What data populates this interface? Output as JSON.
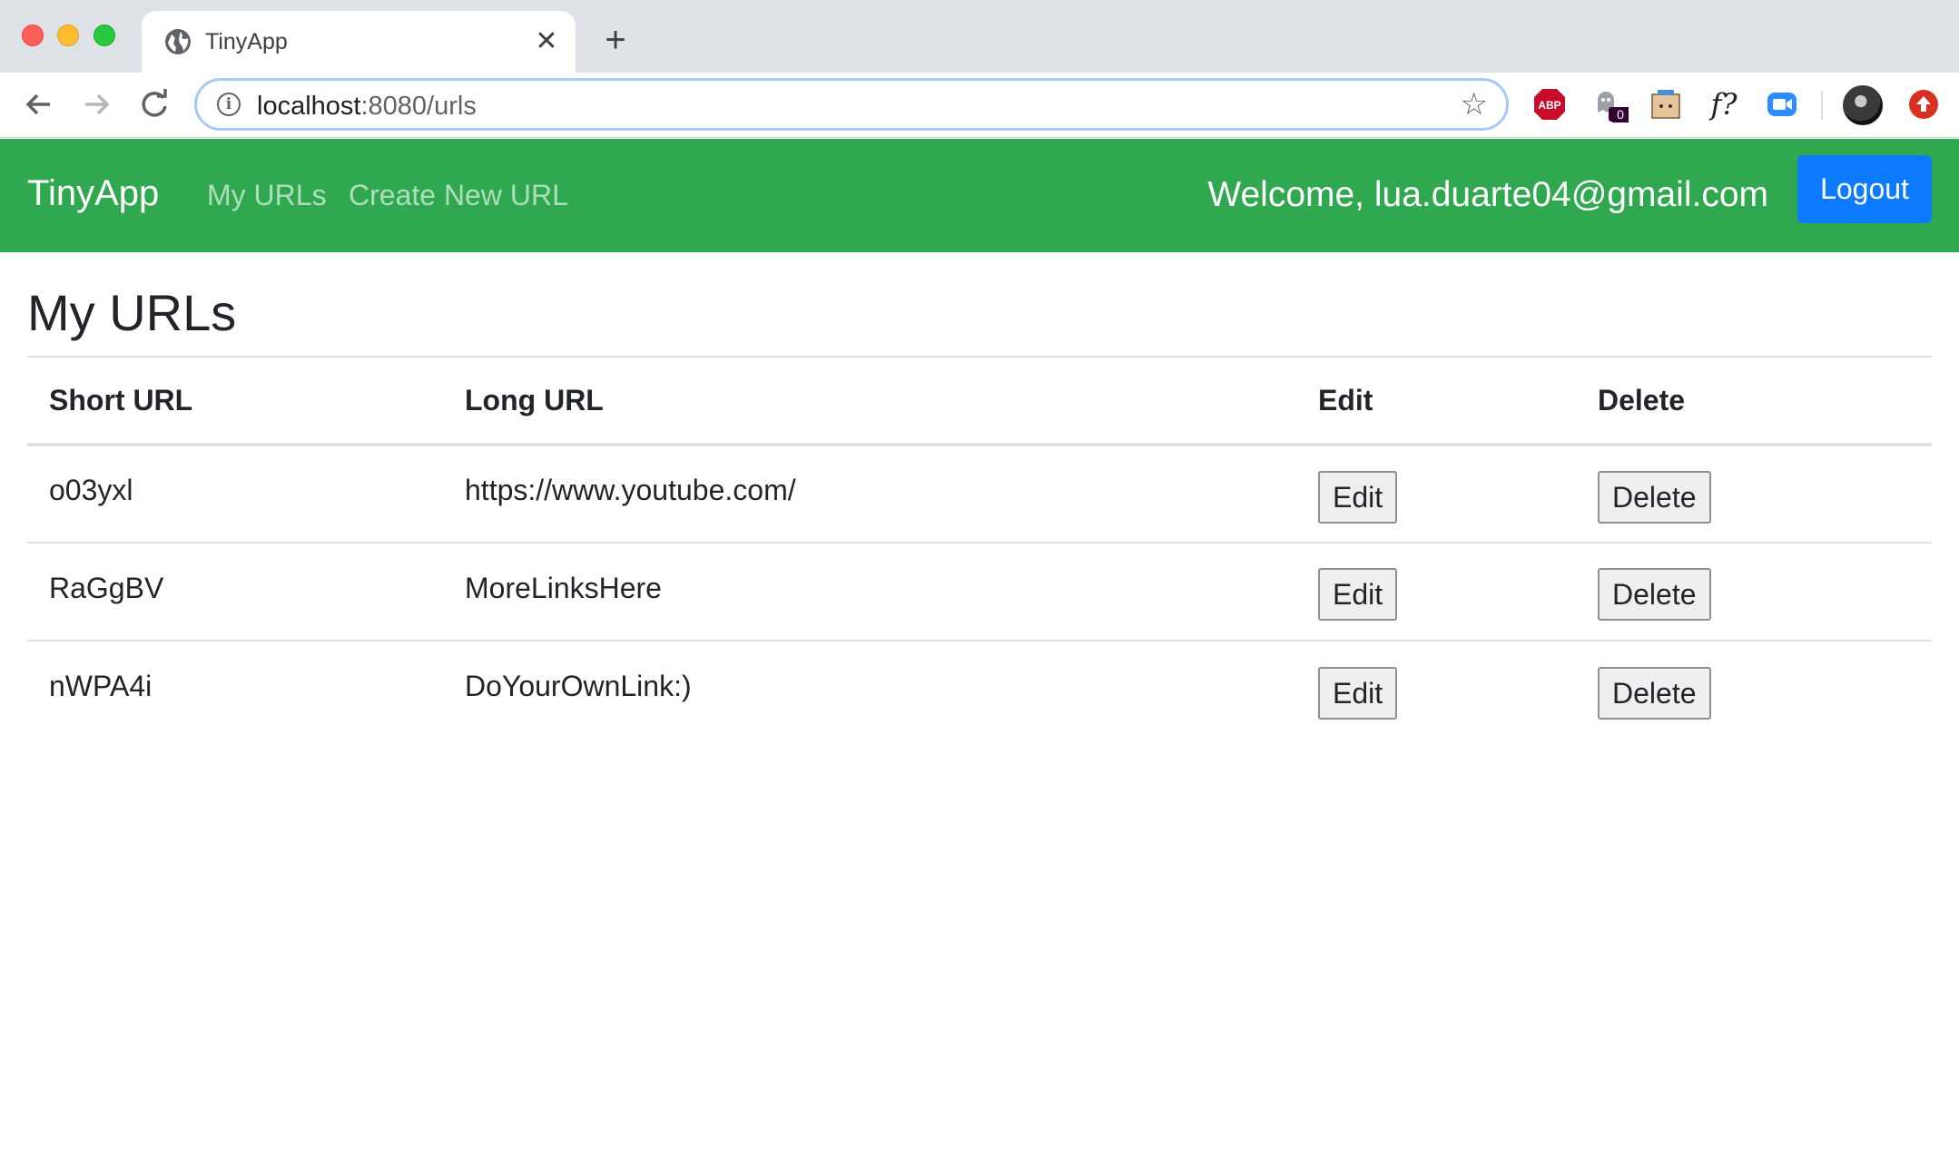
{
  "browser": {
    "tab_title": "TinyApp",
    "tab_close": "✕",
    "new_tab": "+",
    "url_host": "localhost",
    "url_rest": ":8080/urls",
    "ghost_badge": "0",
    "ext_font_label": "f?"
  },
  "navbar": {
    "brand": "TinyApp",
    "links": [
      "My URLs",
      "Create New URL"
    ],
    "welcome": "Welcome, lua.duarte04@gmail.com",
    "logout_label": "Logout",
    "bg_color": "#2fa84f",
    "button_color": "#0d7bff"
  },
  "main": {
    "title": "My URLs",
    "table": {
      "headers": [
        "Short URL",
        "Long URL",
        "Edit",
        "Delete"
      ],
      "rows": [
        {
          "short": "o03yxl",
          "long": "https://www.youtube.com/",
          "edit": "Edit",
          "delete": "Delete"
        },
        {
          "short": "RaGgBV",
          "long": "MoreLinksHere",
          "edit": "Edit",
          "delete": "Delete"
        },
        {
          "short": "nWPA4i",
          "long": "DoYourOwnLink:)",
          "edit": "Edit",
          "delete": "Delete"
        }
      ]
    }
  }
}
